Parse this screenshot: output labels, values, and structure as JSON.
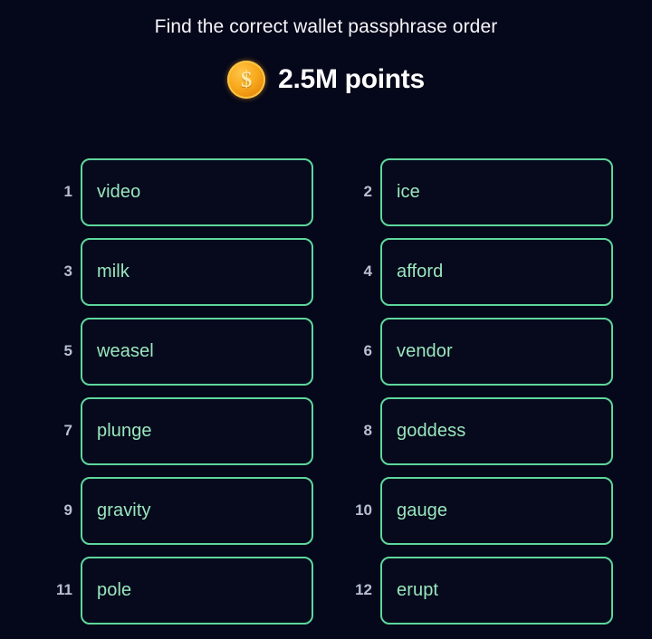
{
  "header": {
    "title": "Find the correct wallet passphrase order",
    "coin_icon": "dollar-coin-icon",
    "coin_glyph": "$",
    "points_label": "2.5M points"
  },
  "colors": {
    "background": "#05071a",
    "box_border": "#5ed69c",
    "word_text": "#9ae6be",
    "index_text": "#b8bfd0",
    "title_text": "#f5f6fa",
    "coin_gold": "#f7a81b"
  },
  "words": [
    {
      "index": "1",
      "word": "video"
    },
    {
      "index": "2",
      "word": "ice"
    },
    {
      "index": "3",
      "word": "milk"
    },
    {
      "index": "4",
      "word": "afford"
    },
    {
      "index": "5",
      "word": "weasel"
    },
    {
      "index": "6",
      "word": "vendor"
    },
    {
      "index": "7",
      "word": "plunge"
    },
    {
      "index": "8",
      "word": "goddess"
    },
    {
      "index": "9",
      "word": "gravity"
    },
    {
      "index": "10",
      "word": "gauge"
    },
    {
      "index": "11",
      "word": "pole"
    },
    {
      "index": "12",
      "word": "erupt"
    }
  ]
}
